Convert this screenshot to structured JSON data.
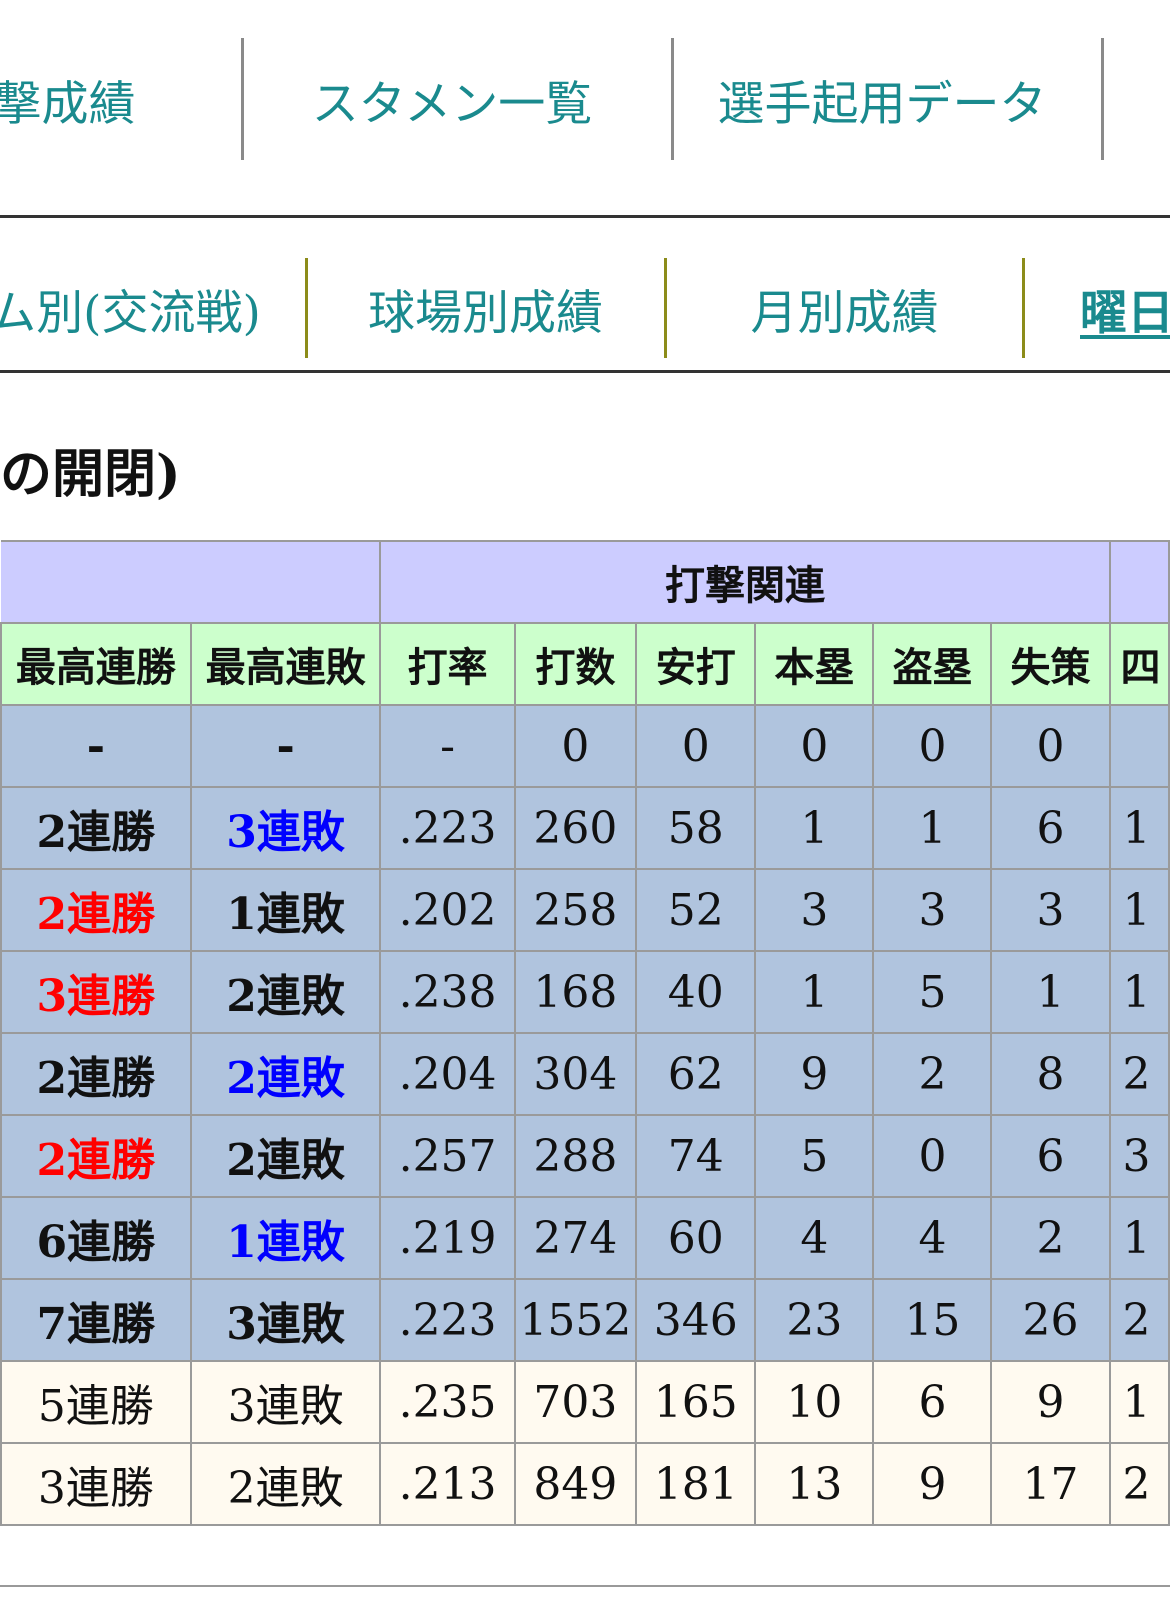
{
  "nav_primary": [
    {
      "label": "撃成績"
    },
    {
      "label": "スタメン一覧"
    },
    {
      "label": "選手起用データ"
    }
  ],
  "nav_secondary": [
    {
      "label": "ム別(交流戦)"
    },
    {
      "label": "球場別成績"
    },
    {
      "label": "月別成績"
    },
    {
      "label": "曜日",
      "active": true
    }
  ],
  "section_heading": "の開閉)",
  "table": {
    "group_header": "打撃関連",
    "headers": [
      "最高連勝",
      "最高連敗",
      "打率",
      "打数",
      "安打",
      "本塁",
      "盗塁",
      "失策",
      "四"
    ],
    "rows": [
      {
        "win": "-",
        "loss": "-",
        "avg": "-",
        "ab": "0",
        "h": "0",
        "hr": "0",
        "sb": "0",
        "e": "0",
        "x": ""
      },
      {
        "win": "2連勝",
        "loss": "3連敗",
        "avg": ".223",
        "ab": "260",
        "h": "58",
        "hr": "1",
        "sb": "1",
        "e": "6",
        "x": "1"
      },
      {
        "win": "2連勝",
        "loss": "1連敗",
        "avg": ".202",
        "ab": "258",
        "h": "52",
        "hr": "3",
        "sb": "3",
        "e": "3",
        "x": "1"
      },
      {
        "win": "3連勝",
        "loss": "2連敗",
        "avg": ".238",
        "ab": "168",
        "h": "40",
        "hr": "1",
        "sb": "5",
        "e": "1",
        "x": "1"
      },
      {
        "win": "2連勝",
        "loss": "2連敗",
        "avg": ".204",
        "ab": "304",
        "h": "62",
        "hr": "9",
        "sb": "2",
        "e": "8",
        "x": "2"
      },
      {
        "win": "2連勝",
        "loss": "2連敗",
        "avg": ".257",
        "ab": "288",
        "h": "74",
        "hr": "5",
        "sb": "0",
        "e": "6",
        "x": "3"
      },
      {
        "win": "6連勝",
        "loss": "1連敗",
        "avg": ".219",
        "ab": "274",
        "h": "60",
        "hr": "4",
        "sb": "4",
        "e": "2",
        "x": "1"
      },
      {
        "win": "7連勝",
        "loss": "3連敗",
        "avg": ".223",
        "ab": "1552",
        "h": "346",
        "hr": "23",
        "sb": "15",
        "e": "26",
        "x": "2"
      },
      {
        "win": "5連勝",
        "loss": "3連敗",
        "avg": ".235",
        "ab": "703",
        "h": "165",
        "hr": "10",
        "sb": "6",
        "e": "9",
        "x": "1"
      },
      {
        "win": "3連勝",
        "loss": "2連敗",
        "avg": ".213",
        "ab": "849",
        "h": "181",
        "hr": "13",
        "sb": "9",
        "e": "17",
        "x": "2"
      }
    ]
  },
  "colors": {
    "nav_link": "#1a8a8e",
    "group_header_bg": "#ccccff",
    "column_header_bg": "#ccffcc",
    "row_bg_blue": "#b0c4de",
    "row_bg_cream": "#fffaf0",
    "streak_red": "#ff0000",
    "streak_blue": "#0000ff"
  }
}
